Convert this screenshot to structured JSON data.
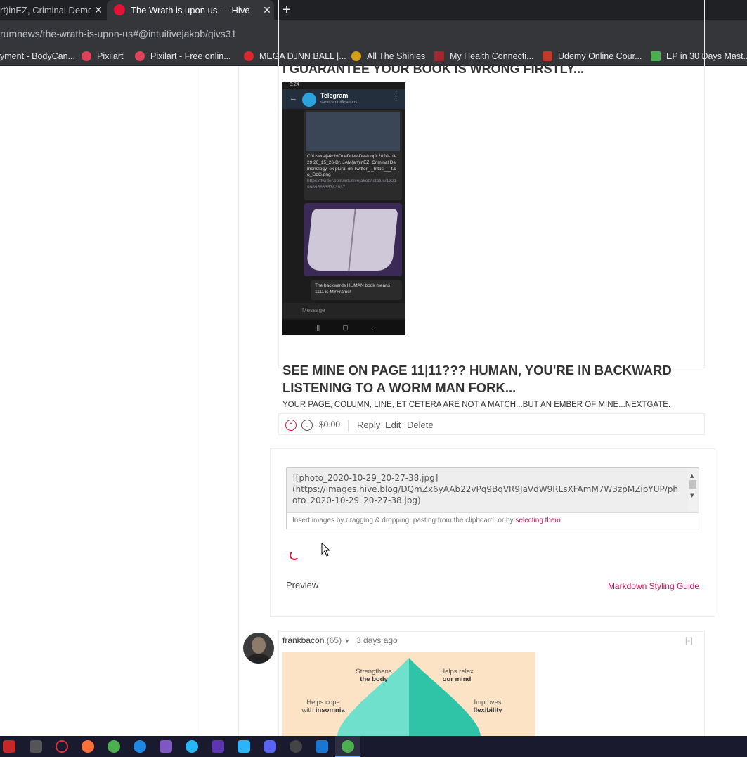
{
  "browser": {
    "tabs": [
      {
        "title": "rt)inEZ, Criminal Demon",
        "close": "✕"
      },
      {
        "title": "The Wrath is upon us — Hive",
        "close": "✕"
      }
    ],
    "new_tab": "+",
    "url": "rumnews/the-wrath-is-upon-us#@intuitivejakob/qivs31",
    "bookmarks": [
      {
        "label": "yment - BodyCan...",
        "color": "#35363a"
      },
      {
        "label": "Pixilart",
        "color": "#e0425a"
      },
      {
        "label": "Pixilart - Free onlin...",
        "color": "#e0425a"
      },
      {
        "label": "MEGA DJNN BALL |...",
        "color": "#d9272e"
      },
      {
        "label": "All The Shinies",
        "color": "#d4a017"
      },
      {
        "label": "My Health Connecti...",
        "color": "#a4262c"
      },
      {
        "label": "Udemy Online Cour...",
        "color": "#c0392b"
      },
      {
        "label": "EP in 30 Days Mast...",
        "color": "#4caf50"
      }
    ]
  },
  "comment": {
    "cut_heading": "I GUARANTEE YOUR BOOK IS WRONG FIRSTLY...",
    "phone": {
      "time": "8:24",
      "chat_name": "Telegram",
      "chat_sub": "service notifications",
      "file_text": "C:\\Users\\jakob\\OneDrive\\Desktop\\ 2020-10-29 20_15_26-Dr. JAM(art)inEZ, Criminal Demonology, ex plural on Twitter_ _https___t.co_GbG.png",
      "link_text": "https://twitter.com/intuitivejakob/ status/1321998956335783937",
      "caption": "The backwards HUMAN book means 1111 is MYFrame!",
      "input_placeholder": "Message"
    },
    "heading": "SEE MINE ON PAGE 11|11??? HUMAN, YOU'RE IN BACKWARD LISTENING TO A WORM MAN FORK...",
    "subline": "YOUR PAGE, COLUMN, LINE, ET CETERA ARE NOT A MATCH...BUT AN EMBER OF MINE...NEXTGATE.",
    "payout": "$0.00",
    "reply": "Reply",
    "edit": "Edit",
    "delete": "Delete"
  },
  "reply_editor": {
    "value": "![photo_2020-10-29_20-27-38.jpg]\n(https://images.hive.blog/DQmZx6yAAb22vPq9BqVR9JaVdW9RLsXFAmM7W3zpMZipYUP/photo_2020-10-29_20-27-38.jpg)",
    "hint_prefix": "Insert images by dragging & dropping, pasting from the clipboard, or by ",
    "hint_link": "selecting them",
    "hint_suffix": ".",
    "preview_label": "Preview",
    "markdown_guide": "Markdown Styling Guide"
  },
  "comment2": {
    "author": "frankbacon",
    "reputation": "(65)",
    "time": "3 days ago",
    "collapse": "[-]",
    "infographic": {
      "label1_top": "Strengthens",
      "label1_bold": "the body",
      "label2_top": "Helps relax",
      "label2_bold": "our mind",
      "label3_top": "Helps cope",
      "label3_with": "with",
      "label3_bold": "insomnia",
      "label4_top": "Improves",
      "label4_bold": "flexibility"
    }
  },
  "colors": {
    "hive_red": "#e31337",
    "link_pink": "#c2185b"
  }
}
